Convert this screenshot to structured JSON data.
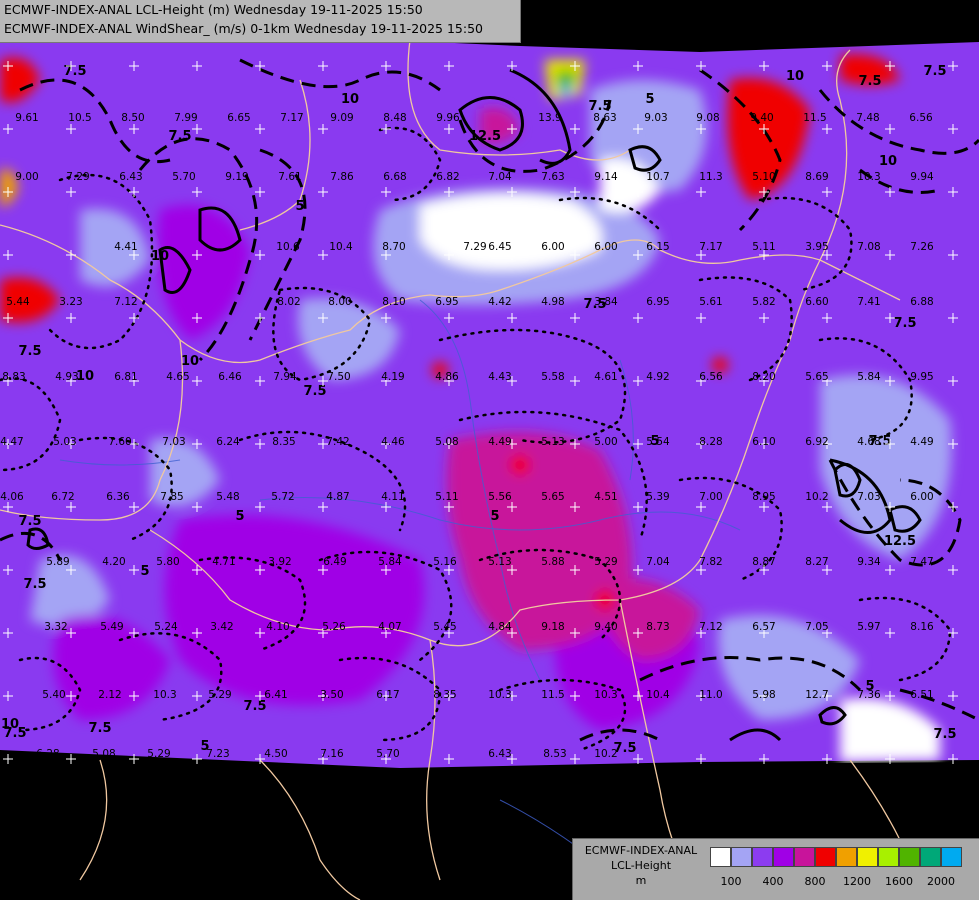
{
  "header": {
    "line1": "ECMWF-INDEX-ANAL LCL-Height (m) Wednesday 19-11-2025 15:50",
    "line2": "ECMWF-INDEX-ANAL WindShear_ (m/s) 0-1km Wednesday 19-11-2025 15:50"
  },
  "legend": {
    "title_lines": [
      "ECMWF-INDEX-ANAL",
      "LCL-Height",
      "m"
    ],
    "colors": [
      "#ffffff",
      "#a4a4f4",
      "#8c3cf0",
      "#a000e6",
      "#c8149b",
      "#f00000",
      "#f0a000",
      "#f0f000",
      "#a8f000",
      "#50b400",
      "#00a878",
      "#00aaf0"
    ],
    "tick_labels": [
      "100",
      "400",
      "800",
      "1200",
      "1600",
      "2000"
    ]
  },
  "map": {
    "contour_labels": [
      "7.5",
      "10",
      "5",
      "12.5"
    ],
    "station_values": [
      "9.61",
      "10.5",
      "8.50",
      "7.99",
      "6.65",
      "7.17",
      "9.09",
      "8.48",
      "9.96",
      "13.9",
      "8.63",
      "9.03",
      "9.08",
      "9.40",
      "11.5",
      "7.48",
      "6.56",
      "9.00",
      "7.29",
      "6.43",
      "5.70",
      "9.19",
      "7.61",
      "7.86",
      "6.68",
      "6.82",
      "7.04",
      "7.63",
      "9.14",
      "10.7",
      "11.3",
      "5.10",
      "8.69",
      "10.3",
      "9.94",
      "4.41",
      "10.6",
      "10.4",
      "8.70",
      "7.29",
      "6.45",
      "6.00",
      "6.00",
      "6.15",
      "7.17",
      "5.11",
      "3.95",
      "7.08",
      "7.26",
      "5.44",
      "3.23",
      "7.12",
      "8.02",
      "8.00",
      "8.10",
      "6.95",
      "4.42",
      "4.98",
      "3.84",
      "6.95",
      "5.61",
      "5.82",
      "6.60",
      "7.41",
      "6.88",
      "8.83",
      "4.93",
      "6.81",
      "4.65",
      "6.46",
      "7.94",
      "7.50",
      "4.19",
      "4.86",
      "4.43",
      "5.58",
      "4.61",
      "4.92",
      "6.56",
      "8.20",
      "5.65",
      "5.84",
      "9.95",
      "4.47",
      "5.03",
      "7.60",
      "7.03",
      "6.24",
      "8.35",
      "7.42",
      "4.46",
      "5.08",
      "4.49",
      "5.13",
      "5.00",
      "5.54",
      "8.28",
      "6.10",
      "6.92",
      "4.68",
      "4.49",
      "4.06",
      "6.72",
      "6.36",
      "7.85",
      "5.48",
      "5.72",
      "4.87",
      "4.11",
      "5.11",
      "5.56",
      "5.65",
      "4.51",
      "5.39",
      "7.00",
      "8.95",
      "10.2",
      "7.03",
      "6.00",
      "5.89",
      "4.20",
      "5.80",
      "4.71",
      "3.92",
      "6.49",
      "5.84",
      "5.16",
      "5.13",
      "5.88",
      "5.29",
      "7.04",
      "7.82",
      "8.87",
      "8.27",
      "9.34",
      "7.47",
      "3.32",
      "5.49",
      "5.24",
      "3.42",
      "4.10",
      "5.26",
      "4.07",
      "5.45",
      "4.84",
      "9.18",
      "9.40",
      "8.73",
      "7.12",
      "6.57",
      "7.05",
      "5.97",
      "8.16",
      "5.40",
      "2.12",
      "10.3",
      "5.29",
      "6.41",
      "3.50",
      "6.17",
      "8.35",
      "10.3",
      "11.5",
      "10.3",
      "10.4",
      "11.0",
      "5.98",
      "12.7",
      "7.36",
      "6.51",
      "6.28",
      "5.08",
      "5.29",
      "7.23",
      "4.50",
      "7.16",
      "5.70",
      "6.43",
      "8.53",
      "10.2"
    ]
  }
}
